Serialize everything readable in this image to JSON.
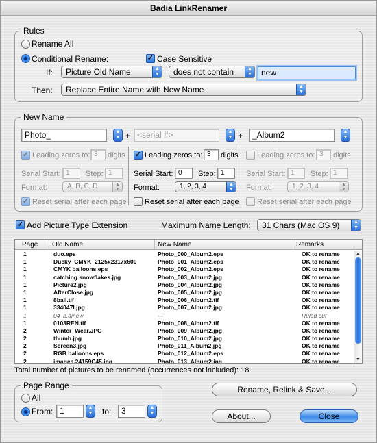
{
  "window": {
    "title": "Badia LinkRenamer"
  },
  "rules": {
    "group_title": "Rules",
    "rename_all_label": "Rename All",
    "conditional_label": "Conditional Rename:",
    "case_sensitive_label": "Case Sensitive",
    "if_label": "If:",
    "if_field": "Picture Old Name",
    "if_operator": "does not contain",
    "if_value": "new",
    "then_label": "Then:",
    "then_action": "Replace Entire Name with New Name"
  },
  "new_name": {
    "group_title": "New Name",
    "plus": "+",
    "field1": "Photo_",
    "field2_placeholder": "<serial #>",
    "field3": "_Album2",
    "columns": [
      {
        "leading_zeros_label": "Leading zeros to:",
        "leading_zeros_value": "3",
        "digits_label": "digits",
        "serial_start_label": "Serial Start:",
        "serial_start_value": "1",
        "step_label": "Step:",
        "step_value": "1",
        "format_label": "Format:",
        "format_value": "A, B, C, D",
        "reset_label": "Reset serial after each page"
      },
      {
        "leading_zeros_label": "Leading zeros to:",
        "leading_zeros_value": "3",
        "digits_label": "digits",
        "serial_start_label": "Serial Start:",
        "serial_start_value": "0",
        "step_label": "Step:",
        "step_value": "1",
        "format_label": "Format:",
        "format_value": "1, 2, 3, 4",
        "reset_label": "Reset serial after each page"
      },
      {
        "leading_zeros_label": "Leading zeros to:",
        "leading_zeros_value": "3",
        "digits_label": "digits",
        "serial_start_label": "Serial Start:",
        "serial_start_value": "1",
        "step_label": "Step:",
        "step_value": "1",
        "format_label": "Format:",
        "format_value": "1, 2, 3, 4",
        "reset_label": "Reset serial after each page"
      }
    ]
  },
  "options": {
    "add_extension_label": "Add Picture Type Extension",
    "max_length_label": "Maximum Name Length:",
    "max_length_value": "31 Chars (Mac OS 9)"
  },
  "table": {
    "headers": [
      "Page",
      "Old Name",
      "New Name",
      "Remarks"
    ],
    "rows": [
      [
        "1",
        "duo.eps",
        "Photo_000_Album2.eps",
        "OK to rename"
      ],
      [
        "1",
        "Ducky_CMYK_2125x2317x600",
        "Photo_001_Album2.eps",
        "OK to rename"
      ],
      [
        "1",
        "CMYK balloons.eps",
        "Photo_002_Album2.eps",
        "OK to rename"
      ],
      [
        "1",
        "catching snowflakes.jpg",
        "Photo_003_Album2.jpg",
        "OK to rename"
      ],
      [
        "1",
        "Picture2.jpg",
        "Photo_004_Album2.jpg",
        "OK to rename"
      ],
      [
        "1",
        "AfterClose.jpg",
        "Photo_005_Album2.jpg",
        "OK to rename"
      ],
      [
        "1",
        "8ball.tif",
        "Photo_006_Album2.tif",
        "OK to rename"
      ],
      [
        "1",
        "334047l.jpg",
        "Photo_007_Album2.jpg",
        "OK to rename"
      ],
      [
        "1",
        "04_b.ainew",
        "—",
        "Ruled out"
      ],
      [
        "1",
        "0103REN.tif",
        "Photo_008_Album2.tif",
        "OK to rename"
      ],
      [
        "2",
        "Winter_Wear.JPG",
        "Photo_009_Album2.jpg",
        "OK to rename"
      ],
      [
        "2",
        "thumb.jpg",
        "Photo_010_Album2.jpg",
        "OK to rename"
      ],
      [
        "2",
        "Screen3.jpg",
        "Photo_011_Album2.jpg",
        "OK to rename"
      ],
      [
        "2",
        "RGB balloons.eps",
        "Photo_012_Album2.eps",
        "OK to rename"
      ],
      [
        "2",
        "images.24159C45.jpg",
        "Photo_013_Album2.jpg",
        "OK to rename"
      ]
    ]
  },
  "total_text": "Total number of pictures to be renamed (occurrences not included): 18",
  "page_range": {
    "group_title": "Page Range",
    "all_label": "All",
    "from_label": "From:",
    "from_value": "1",
    "to_label": "to:",
    "to_value": "3"
  },
  "buttons": {
    "rename": "Rename, Relink & Save...",
    "about": "About...",
    "close": "Close"
  }
}
